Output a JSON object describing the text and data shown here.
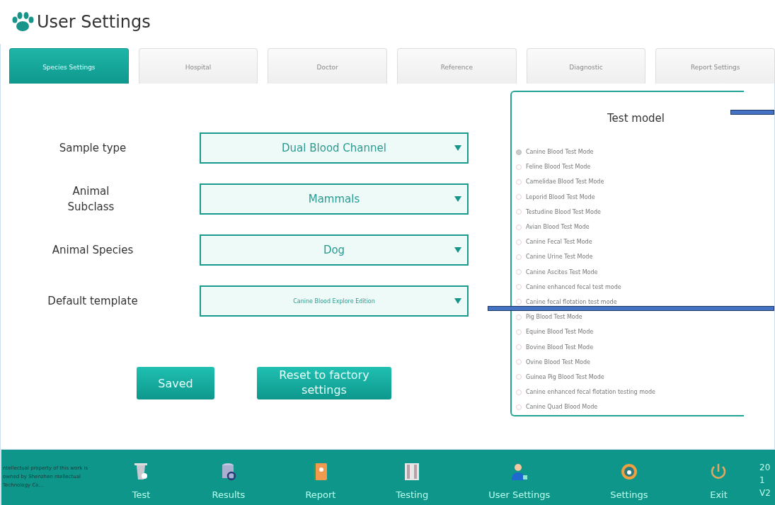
{
  "window": {
    "title": "User Settings"
  },
  "tabs": [
    {
      "label": "Species Settings",
      "selected": true
    },
    {
      "label": "Hospital",
      "selected": false
    },
    {
      "label": "Doctor",
      "selected": false
    },
    {
      "label": "Reference",
      "selected": false
    },
    {
      "label": "Diagnostic",
      "selected": false
    },
    {
      "label": "Report Settings",
      "selected": false
    }
  ],
  "form": [
    {
      "label": "Sample type",
      "value": "Dual Blood Channel",
      "small": false
    },
    {
      "label": "Animal Subclass",
      "value": "Mammals",
      "small": false
    },
    {
      "label": "Animal Species",
      "value": "Dog",
      "small": false
    },
    {
      "label": "Default template",
      "value": "Canine Blood Explore Edition",
      "small": true
    }
  ],
  "buttons": [
    {
      "label": "Saved"
    },
    {
      "label": "Reset to factory settings"
    }
  ],
  "test_model": {
    "title": "Test model",
    "options": [
      {
        "label": "Canine Blood Test Mode",
        "selected": true
      },
      {
        "label": "Feline Blood Test Mode",
        "selected": false
      },
      {
        "label": "Camelidae Blood Test Mode",
        "selected": false
      },
      {
        "label": "Leporid Blood Test Mode",
        "selected": false
      },
      {
        "label": "Testudine Blood Test Mode",
        "selected": false
      },
      {
        "label": "Avian Blood Test Mode",
        "selected": false
      },
      {
        "label": "Canine Fecal Test Mode",
        "selected": false
      },
      {
        "label": "Canine Urine Test Mode",
        "selected": false
      },
      {
        "label": "Canine Ascites Test Mode",
        "selected": false
      },
      {
        "label": "Canine enhanced fecal test mode",
        "selected": false
      },
      {
        "label": "Canine fecal flotation test mode",
        "selected": false
      },
      {
        "label": "Pig Blood Test Mode",
        "selected": false
      },
      {
        "label": "Equine Blood Test Mode",
        "selected": false
      },
      {
        "label": "Bovine Blood Test Mode",
        "selected": false
      },
      {
        "label": "Ovine Blood Test Mode",
        "selected": false
      },
      {
        "label": "Guinea Pig Blood Test Mode",
        "selected": false
      },
      {
        "label": "Canine enhanced fecal flotation testing mode",
        "selected": false
      },
      {
        "label": "Canine Quad Blood Mode",
        "selected": false
      }
    ]
  },
  "footer": {
    "notice": "ntellectual property of this work is owned by Shenzhen ntellectual Technology Co...",
    "nav": [
      {
        "label": "Test",
        "kind": "test"
      },
      {
        "label": "Results",
        "kind": "results"
      },
      {
        "label": "Report",
        "kind": "report"
      },
      {
        "label": "Testing",
        "kind": "testing"
      },
      {
        "label": "User Settings",
        "kind": "user"
      },
      {
        "label": "Settings",
        "kind": "settings"
      },
      {
        "label": "Exit",
        "kind": "exit"
      }
    ],
    "status": [
      "20",
      "1",
      "V2"
    ]
  }
}
